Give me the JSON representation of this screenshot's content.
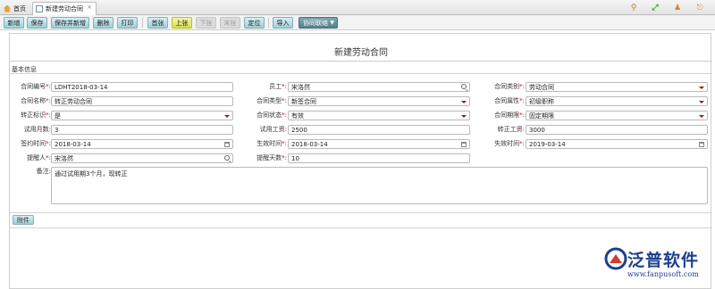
{
  "tabs": [
    {
      "label": "首页"
    },
    {
      "label": "新建劳动合同"
    }
  ],
  "tab_close": "×",
  "toolbar": {
    "new": "新增",
    "save": "保存",
    "save_new": "保存并新增",
    "delete": "删除",
    "print": "打印",
    "first": "首张",
    "prev": "上张",
    "next": "下张",
    "last": "末张",
    "locate": "定位",
    "import": "导入",
    "assist": "协同联络"
  },
  "form": {
    "title": "新建劳动合同",
    "section": "基本信息",
    "fields": {
      "contract_no": {
        "label": "合同编号",
        "value": "LDHT2018-03-14"
      },
      "employee": {
        "label": "员工",
        "value": "宋洛然"
      },
      "contract_category": {
        "label": "合同类别",
        "value": "劳动合同"
      },
      "contract_name": {
        "label": "合同名称",
        "value": "转正劳动合同"
      },
      "contract_type": {
        "label": "合同类型",
        "value": "新签合同"
      },
      "contract_property": {
        "label": "合同属性",
        "value": "初级职称"
      },
      "regular_flag": {
        "label": "转正标识",
        "value": "是"
      },
      "contract_status": {
        "label": "合同状态",
        "value": "有效"
      },
      "contract_term": {
        "label": "合同期限",
        "value": "固定期限"
      },
      "probation_months": {
        "label": "试用月数",
        "value": "3"
      },
      "probation_salary": {
        "label": "试用工资",
        "value": "2500"
      },
      "regular_salary": {
        "label": "转正工资",
        "value": "3000"
      },
      "sign_date": {
        "label": "签约时间",
        "value": "2018-03-14"
      },
      "effective_date": {
        "label": "生效时间",
        "value": "2018-03-14"
      },
      "expiry_date": {
        "label": "失效时间",
        "value": "2019-03-14"
      },
      "reminder_person": {
        "label": "提醒人",
        "value": "宋洛然"
      },
      "reminder_days": {
        "label": "提醒天数",
        "value": "10"
      },
      "remark": {
        "label": "备注",
        "value": "通过试用期3个月，现转正"
      }
    },
    "attach": "附件"
  },
  "logo": {
    "name": "泛普软件",
    "url": "www.fanpusoft.com"
  },
  "colors": {
    "accent_button": "#9fcdd5",
    "highlight_button": "#d8dc4b",
    "required": "#dd0000",
    "brand": "#1e3f8c"
  }
}
